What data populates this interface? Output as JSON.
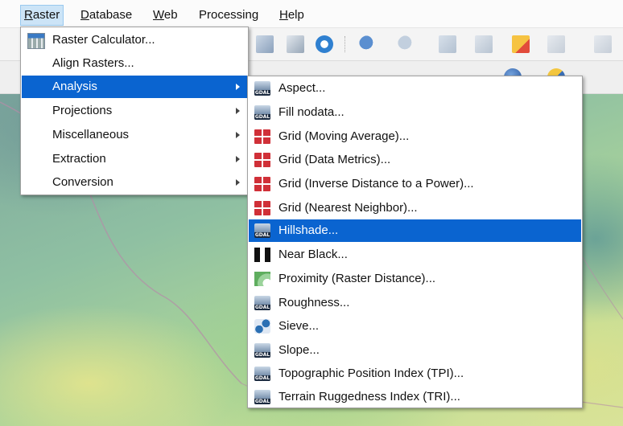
{
  "menubar": {
    "items": [
      {
        "label": "Raster",
        "mnemonic": "R",
        "rest": "aster",
        "active": true
      },
      {
        "label": "Database",
        "mnemonic": "D",
        "rest": "atabase"
      },
      {
        "label": "Web",
        "mnemonic": "W",
        "rest": "eb"
      },
      {
        "label": "Processing",
        "mnemonic": "",
        "rest": "Processing"
      },
      {
        "label": "Help",
        "mnemonic": "H",
        "rest": "elp"
      }
    ]
  },
  "raster_menu": {
    "items": [
      {
        "label": "Raster Calculator...",
        "icon": "raster-calculator-icon"
      },
      {
        "label": "Align Rasters..."
      },
      {
        "label": "Analysis",
        "submenu": true,
        "highlight": true
      },
      {
        "label": "Projections",
        "submenu": true
      },
      {
        "label": "Miscellaneous",
        "submenu": true
      },
      {
        "label": "Extraction",
        "submenu": true
      },
      {
        "label": "Conversion",
        "submenu": true
      }
    ]
  },
  "analysis_submenu": {
    "items": [
      {
        "label": "Aspect...",
        "icon": "gdal-icon"
      },
      {
        "label": "Fill nodata...",
        "icon": "gdal-icon"
      },
      {
        "label": "Grid (Moving Average)...",
        "icon": "grid-icon"
      },
      {
        "label": "Grid (Data Metrics)...",
        "icon": "grid-icon"
      },
      {
        "label": "Grid (Inverse Distance to a Power)...",
        "icon": "grid-icon"
      },
      {
        "label": "Grid (Nearest Neighbor)...",
        "icon": "grid-icon"
      },
      {
        "label": "Hillshade...",
        "icon": "gdal-icon",
        "highlight": true
      },
      {
        "label": "Near Black...",
        "icon": "near-black-icon"
      },
      {
        "label": "Proximity (Raster Distance)...",
        "icon": "proximity-icon"
      },
      {
        "label": "Roughness...",
        "icon": "gdal-icon"
      },
      {
        "label": "Sieve...",
        "icon": "sieve-icon"
      },
      {
        "label": "Slope...",
        "icon": "gdal-icon"
      },
      {
        "label": "Topographic Position Index (TPI)...",
        "icon": "gdal-icon"
      },
      {
        "label": "Terrain Ruggedness Index (TRI)...",
        "icon": "gdal-icon"
      }
    ]
  },
  "colors": {
    "highlight": "#0a64d0",
    "menubar_active": "#cce4f7"
  }
}
